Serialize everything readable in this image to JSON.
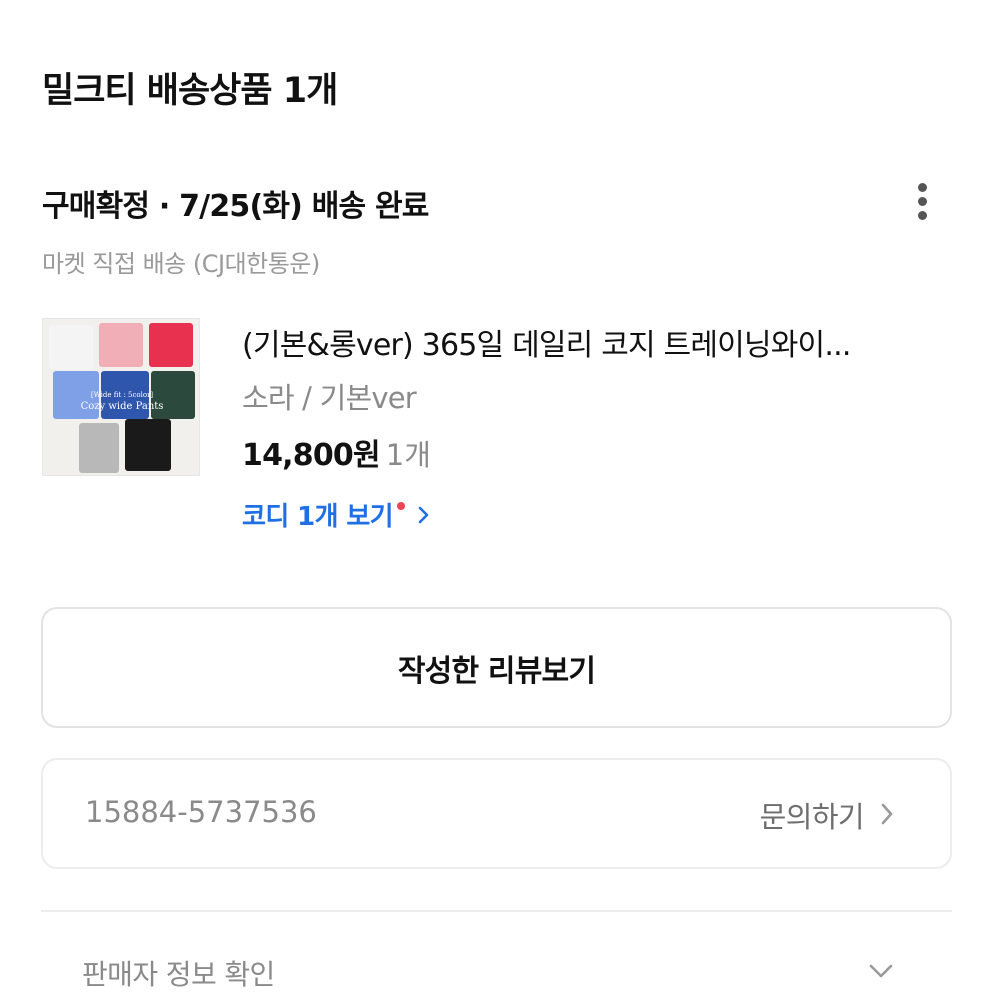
{
  "header": {
    "title": "밀크티 배송상품 1개"
  },
  "order": {
    "status": "구매확정 · 7/25(화) 배송 완료",
    "delivery": "마켓 직접 배송 (CJ대한통운)",
    "more_icon": "more-vertical-icon"
  },
  "product": {
    "name": "(기본&롱ver) 365일 데일리 코지 트레이닝와이...",
    "option": "소라 / 기본ver",
    "price": "14,800원",
    "quantity": "1개",
    "image_caption_line1": "[Wide fit : 5color]",
    "image_caption_line2": "Cozy wide Pants",
    "codi_link": "코디 1개 보기",
    "pant_colors": [
      "#f4f4f4",
      "#f2aeb6",
      "#e8304f",
      "#7f9fe6",
      "#2f56ad",
      "#2b4a3d",
      "#b8b8b8",
      "#1a1a1a"
    ]
  },
  "actions": {
    "review_button": "작성한 리뷰보기"
  },
  "contact": {
    "phone": "15884-5737536",
    "inquiry_label": "문의하기"
  },
  "seller": {
    "label": "판매자 정보 확인"
  },
  "colors": {
    "accent": "#1f6fe5",
    "new_dot": "#f04452",
    "muted": "#8a8a8a"
  }
}
